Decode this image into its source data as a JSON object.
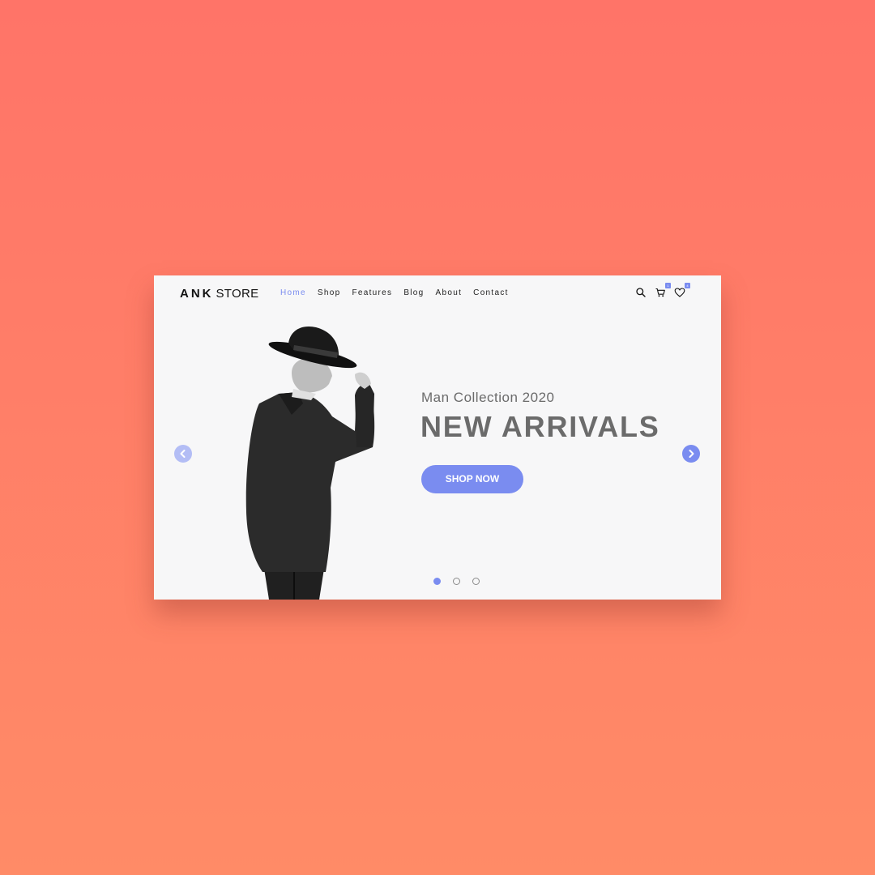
{
  "header": {
    "logo_brand": "ANK",
    "logo_suffix": "STORE",
    "nav": [
      "Home",
      "Shop",
      "Features",
      "Blog",
      "About",
      "Contact"
    ],
    "active_nav": "Home",
    "icons": [
      "search-icon",
      "cart-icon",
      "heart-icon"
    ],
    "cart_count": "1",
    "wishlist_count": "4"
  },
  "hero": {
    "subtitle": "Man Collection 2020",
    "title": "NEW ARRIVALS",
    "cta_label": "SHOP NOW",
    "slide_count": 3,
    "active_slide": 1
  },
  "colors": {
    "accent": "#7a8cf0",
    "accent_light": "#b3bdf5",
    "text_gray": "#6b6b6b",
    "card_bg": "#f7f7f8",
    "bg_top": "#ff7468",
    "bg_bottom": "#ff8b67"
  }
}
